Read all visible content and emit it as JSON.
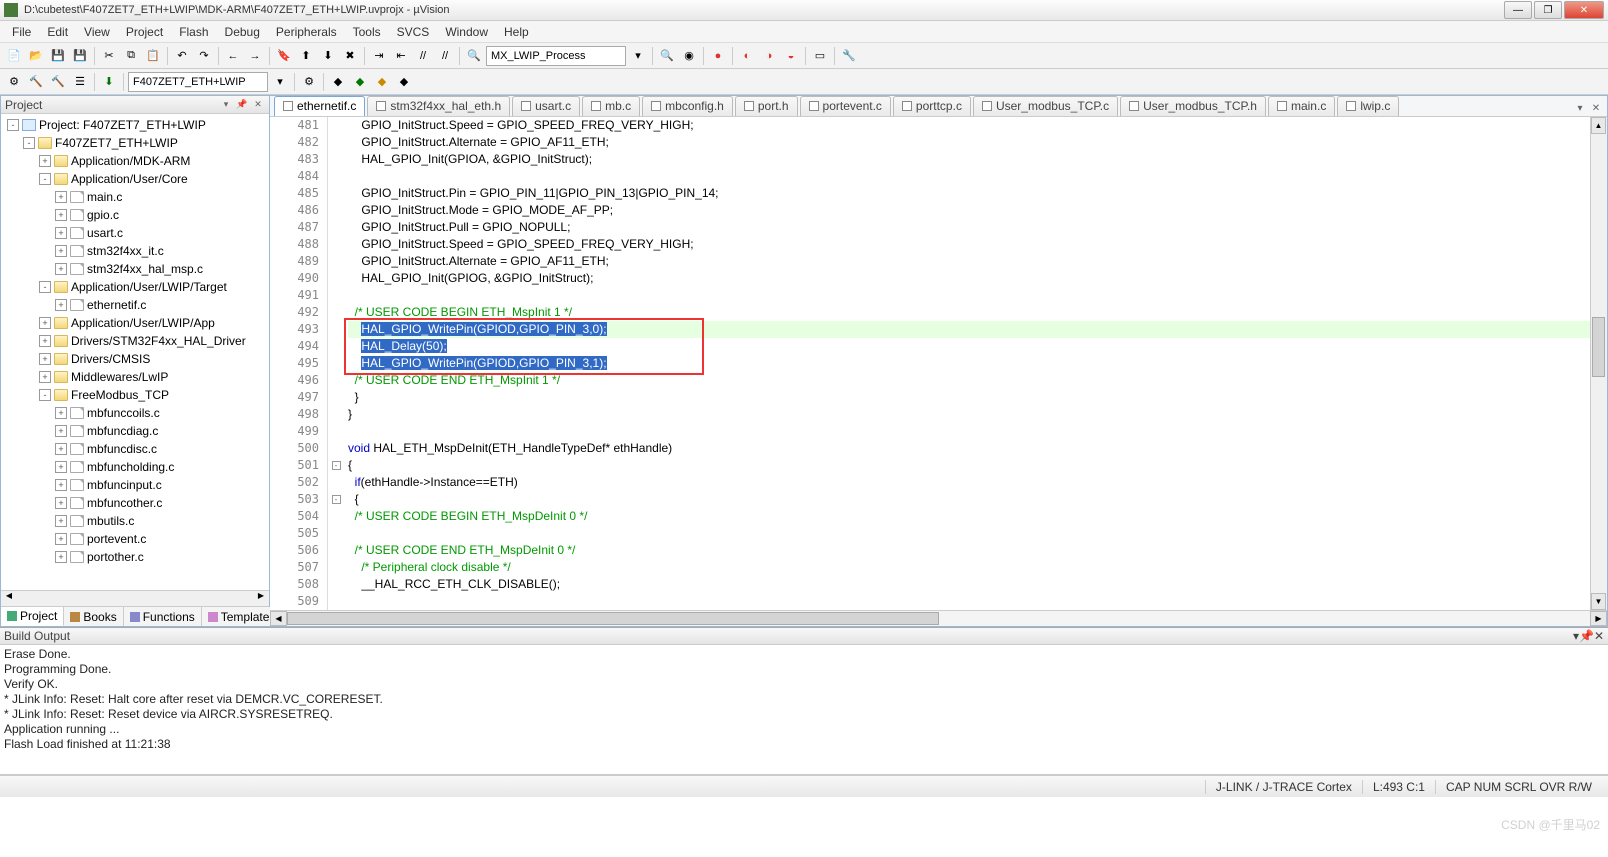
{
  "window": {
    "title": "D:\\cubetest\\F407ZET7_ETH+LWIP\\MDK-ARM\\F407ZET7_ETH+LWIP.uvprojx - µVision",
    "min": "—",
    "max": "❐",
    "close": "✕"
  },
  "menu": [
    "File",
    "Edit",
    "View",
    "Project",
    "Flash",
    "Debug",
    "Peripherals",
    "Tools",
    "SVCS",
    "Window",
    "Help"
  ],
  "toolbar2": {
    "target": "F407ZET7_ETH+LWIP",
    "proc": "MX_LWIP_Process"
  },
  "projectPanel": {
    "title": "Project",
    "tabs": [
      "Project",
      "Books",
      "Functions",
      "Templates"
    ]
  },
  "tree": [
    {
      "d": 0,
      "e": "-",
      "t": "project",
      "l": "Project: F407ZET7_ETH+LWIP"
    },
    {
      "d": 1,
      "e": "-",
      "t": "folder",
      "l": "F407ZET7_ETH+LWIP"
    },
    {
      "d": 2,
      "e": "+",
      "t": "folder",
      "l": "Application/MDK-ARM"
    },
    {
      "d": 2,
      "e": "-",
      "t": "folder",
      "l": "Application/User/Core"
    },
    {
      "d": 3,
      "e": "+",
      "t": "file",
      "l": "main.c"
    },
    {
      "d": 3,
      "e": "+",
      "t": "file",
      "l": "gpio.c"
    },
    {
      "d": 3,
      "e": "+",
      "t": "file",
      "l": "usart.c"
    },
    {
      "d": 3,
      "e": "+",
      "t": "file",
      "l": "stm32f4xx_it.c"
    },
    {
      "d": 3,
      "e": "+",
      "t": "file",
      "l": "stm32f4xx_hal_msp.c"
    },
    {
      "d": 2,
      "e": "-",
      "t": "folder",
      "l": "Application/User/LWIP/Target"
    },
    {
      "d": 3,
      "e": "+",
      "t": "file",
      "l": "ethernetif.c"
    },
    {
      "d": 2,
      "e": "+",
      "t": "folder",
      "l": "Application/User/LWIP/App"
    },
    {
      "d": 2,
      "e": "+",
      "t": "folder",
      "l": "Drivers/STM32F4xx_HAL_Driver"
    },
    {
      "d": 2,
      "e": "+",
      "t": "folder",
      "l": "Drivers/CMSIS"
    },
    {
      "d": 2,
      "e": "+",
      "t": "folder",
      "l": "Middlewares/LwIP"
    },
    {
      "d": 2,
      "e": "-",
      "t": "folder",
      "l": "FreeModbus_TCP"
    },
    {
      "d": 3,
      "e": "+",
      "t": "file",
      "l": "mbfunccoils.c"
    },
    {
      "d": 3,
      "e": "+",
      "t": "file",
      "l": "mbfuncdiag.c"
    },
    {
      "d": 3,
      "e": "+",
      "t": "file",
      "l": "mbfuncdisc.c"
    },
    {
      "d": 3,
      "e": "+",
      "t": "file",
      "l": "mbfuncholding.c"
    },
    {
      "d": 3,
      "e": "+",
      "t": "file",
      "l": "mbfuncinput.c"
    },
    {
      "d": 3,
      "e": "+",
      "t": "file",
      "l": "mbfuncother.c"
    },
    {
      "d": 3,
      "e": "+",
      "t": "file",
      "l": "mbutils.c"
    },
    {
      "d": 3,
      "e": "+",
      "t": "file",
      "l": "portevent.c"
    },
    {
      "d": 3,
      "e": "+",
      "t": "file",
      "l": "portother.c"
    }
  ],
  "fileTabs": [
    {
      "label": "ethernetif.c",
      "active": true,
      "bg": "#d9ffcf"
    },
    {
      "label": "stm32f4xx_hal_eth.h",
      "bg": "#ffd4dc"
    },
    {
      "label": "usart.c",
      "bg": "#fff"
    },
    {
      "label": "mb.c",
      "bg": "#fff6cc"
    },
    {
      "label": "mbconfig.h",
      "bg": "#d9ffcf"
    },
    {
      "label": "port.h",
      "bg": "#ffd4dc"
    },
    {
      "label": "portevent.c",
      "bg": "#fff"
    },
    {
      "label": "porttcp.c",
      "bg": "#fff6cc"
    },
    {
      "label": "User_modbus_TCP.c",
      "bg": "#d9ffcf"
    },
    {
      "label": "User_modbus_TCP.h",
      "bg": "#ffd4dc"
    },
    {
      "label": "main.c",
      "bg": "#fff"
    },
    {
      "label": "lwip.c",
      "bg": "#fff6cc"
    }
  ],
  "code": {
    "start": 481,
    "lines": [
      {
        "t": "    GPIO_InitStruct.Speed = GPIO_SPEED_FREQ_VERY_HIGH;"
      },
      {
        "t": "    GPIO_InitStruct.Alternate = GPIO_AF11_ETH;"
      },
      {
        "t": "    HAL_GPIO_Init(GPIOA, &GPIO_InitStruct);"
      },
      {
        "t": ""
      },
      {
        "t": "    GPIO_InitStruct.Pin = GPIO_PIN_11|GPIO_PIN_13|GPIO_PIN_14;"
      },
      {
        "t": "    GPIO_InitStruct.Mode = GPIO_MODE_AF_PP;"
      },
      {
        "t": "    GPIO_InitStruct.Pull = GPIO_NOPULL;"
      },
      {
        "t": "    GPIO_InitStruct.Speed = GPIO_SPEED_FREQ_VERY_HIGH;"
      },
      {
        "t": "    GPIO_InitStruct.Alternate = GPIO_AF11_ETH;"
      },
      {
        "t": "    HAL_GPIO_Init(GPIOG, &GPIO_InitStruct);"
      },
      {
        "t": ""
      },
      {
        "t": "  /* USER CODE BEGIN ETH_MspInit 1 */",
        "cmt": true
      },
      {
        "t": "    HAL_GPIO_WritePin(GPIOD,GPIO_PIN_3,0);",
        "hl": true,
        "sel": true
      },
      {
        "t": "    HAL_Delay(50);",
        "sel": true
      },
      {
        "t": "    HAL_GPIO_WritePin(GPIOD,GPIO_PIN_3,1);",
        "sel": true
      },
      {
        "t": "  /* USER CODE END ETH_MspInit 1 */",
        "cmt": true
      },
      {
        "t": "  }"
      },
      {
        "t": "}"
      },
      {
        "t": ""
      },
      {
        "t": "void HAL_ETH_MspDeInit(ETH_HandleTypeDef* ethHandle)",
        "kw": "void"
      },
      {
        "t": "{",
        "fold": "-"
      },
      {
        "t": "  if(ethHandle->Instance==ETH)",
        "kw": "if"
      },
      {
        "t": "  {",
        "fold": "-"
      },
      {
        "t": "  /* USER CODE BEGIN ETH_MspDeInit 0 */",
        "cmt": true
      },
      {
        "t": ""
      },
      {
        "t": "  /* USER CODE END ETH_MspDeInit 0 */",
        "cmt": true
      },
      {
        "t": "    /* Peripheral clock disable */",
        "cmt": true
      },
      {
        "t": "    __HAL_RCC_ETH_CLK_DISABLE();"
      },
      {
        "t": ""
      }
    ]
  },
  "buildOutput": {
    "title": "Build Output",
    "lines": [
      "Erase Done.",
      "Programming Done.",
      "Verify OK.",
      "* JLink Info: Reset: Halt core after reset via DEMCR.VC_CORERESET.",
      "* JLink Info: Reset: Reset device via AIRCR.SYSRESETREQ.",
      "Application running ...",
      "Flash Load finished at 11:21:38"
    ]
  },
  "status": {
    "debugger": "J-LINK / J-TRACE Cortex",
    "pos": "L:493 C:1",
    "ind": "CAP  NUM  SCRL  OVR  R/W"
  },
  "watermark": "CSDN @千里马02"
}
